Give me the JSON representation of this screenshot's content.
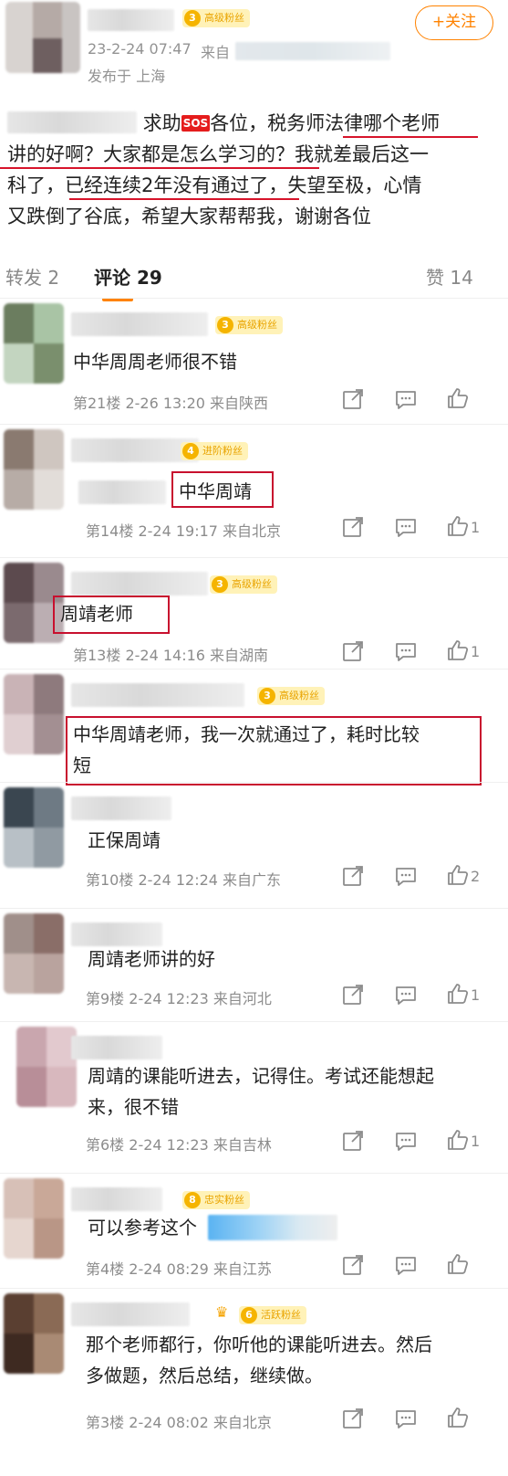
{
  "post": {
    "fan_badge": {
      "level": "3",
      "label": "高级粉丝"
    },
    "time": "23-2-24 07:47",
    "source_prefix": "来自",
    "location": "发布于 上海",
    "follow_label": "+关注",
    "body": {
      "line1_before": "求助",
      "sos": "SOS",
      "line1_after": "各位，税务师法律哪个老师",
      "line2": "讲的好啊？大家都是怎么学习的？我就差最后这一",
      "line3": "科了，已经连续2年没有通过了，失望至极，心情",
      "line4": "又跌倒了谷底，希望大家帮帮我，谢谢各位"
    }
  },
  "tabs": {
    "repost": "转发 2",
    "comments": "评论 29",
    "likes": "赞 14"
  },
  "comments": [
    {
      "badge_level": "3",
      "badge": "高级粉丝",
      "text": [
        "中华周周老师很不错"
      ],
      "meta": "第21楼  2-26 13:20  来自陕西",
      "likes": ""
    },
    {
      "badge_level": "4",
      "badge": "进阶粉丝",
      "text": [
        "中华周靖"
      ],
      "meta": "第14楼  2-24 19:17  来自北京",
      "likes": "1"
    },
    {
      "badge_level": "3",
      "badge": "高级粉丝",
      "text": [
        "周靖老师"
      ],
      "meta": "第13楼  2-24 14:16  来自湖南",
      "likes": "1"
    },
    {
      "badge_level": "3",
      "badge": "高级粉丝",
      "text": [
        "中华周靖老师，我一次就通过了，耗时比较",
        "短"
      ],
      "meta": "",
      "likes": ""
    },
    {
      "badge_level": "",
      "badge": "",
      "text": [
        "正保周靖"
      ],
      "meta": "第10楼  2-24 12:24  来自广东",
      "likes": "2"
    },
    {
      "badge_level": "",
      "badge": "",
      "text": [
        "周靖老师讲的好"
      ],
      "meta": "第9楼  2-24 12:23  来自河北",
      "likes": "1"
    },
    {
      "badge_level": "",
      "badge": "",
      "text": [
        "周靖的课能听进去，记得住。考试还能想起",
        "来，很不错"
      ],
      "meta": "第6楼  2-24 12:23  来自吉林",
      "likes": "1"
    },
    {
      "badge_level": "8",
      "badge": "忠实粉丝",
      "text": [
        "可以参考这个"
      ],
      "meta": "第4楼  2-24 08:29  来自江苏",
      "likes": ""
    },
    {
      "badge_level": "6",
      "badge": "活跃粉丝",
      "text": [
        "那个老师都行，你听他的课能听进去。然后",
        "多做题，然后总结，继续做。"
      ],
      "meta": "第3楼  2-24 08:02  来自北京",
      "likes": ""
    }
  ],
  "colors": {
    "accent": "#ff8200",
    "highlight_red": "#c8102e",
    "badge_bg": "#fff2b8",
    "meta_gray": "#8c8c8c"
  },
  "icons": [
    "share-icon",
    "reply-icon",
    "like-icon"
  ]
}
